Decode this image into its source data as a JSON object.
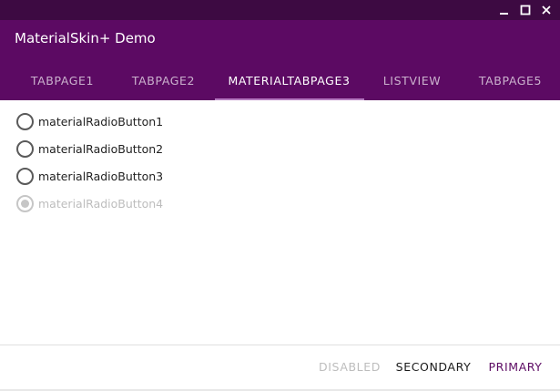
{
  "window": {
    "controls": [
      {
        "icon": "minimize-icon"
      },
      {
        "icon": "maximize-icon"
      },
      {
        "icon": "close-icon"
      }
    ]
  },
  "app": {
    "title": "MaterialSkin+ Demo",
    "primary_color": "#5c0a63",
    "primary_dark_color": "#3d0a42",
    "accent_color": "#b57ac0"
  },
  "tabs": [
    {
      "label": "TABPAGE1",
      "selected": false
    },
    {
      "label": "TABPAGE2",
      "selected": false
    },
    {
      "label": "MATERIALTABPAGE3",
      "selected": true
    },
    {
      "label": "LISTVIEW",
      "selected": false
    },
    {
      "label": "TABPAGE5",
      "selected": false
    }
  ],
  "radios": [
    {
      "label": "materialRadioButton1",
      "checked": false,
      "enabled": true
    },
    {
      "label": "materialRadioButton2",
      "checked": false,
      "enabled": true
    },
    {
      "label": "materialRadioButton3",
      "checked": false,
      "enabled": true
    },
    {
      "label": "materialRadioButton4",
      "checked": true,
      "enabled": false
    }
  ],
  "buttons": {
    "disabled_label": "DISABLED",
    "secondary_label": "SECONDARY",
    "primary_label": "PRIMARY"
  }
}
